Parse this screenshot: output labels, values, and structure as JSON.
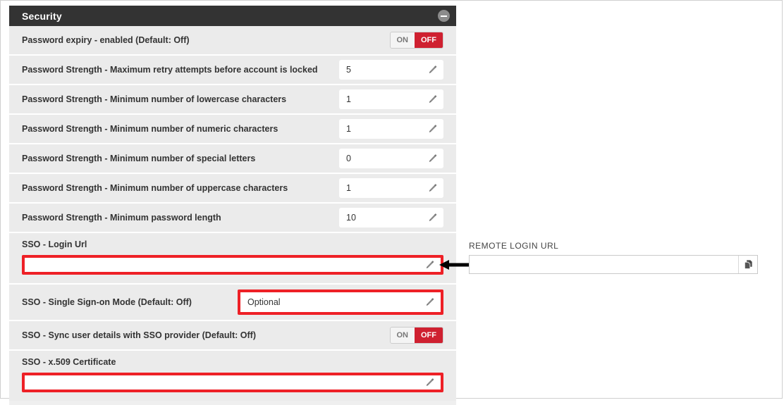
{
  "panel": {
    "title": "Security",
    "collapse_icon": "minus-circle-icon",
    "rows": [
      {
        "label": "Password expiry - enabled (Default: Off)",
        "control": "toggle",
        "toggle": {
          "on_label": "ON",
          "off_label": "OFF",
          "state": "OFF"
        }
      },
      {
        "label": "Password Strength - Maximum retry attempts before account is locked",
        "control": "value",
        "value": "5"
      },
      {
        "label": "Password Strength - Minimum number of lowercase characters",
        "control": "value",
        "value": "1"
      },
      {
        "label": "Password Strength - Minimum number of numeric characters",
        "control": "value",
        "value": "1"
      },
      {
        "label": "Password Strength - Minimum number of special letters",
        "control": "value",
        "value": "0"
      },
      {
        "label": "Password Strength - Minimum number of uppercase characters",
        "control": "value",
        "value": "1"
      },
      {
        "label": "Password Strength - Minimum password length",
        "control": "value",
        "value": "10"
      },
      {
        "label": "SSO - Login Url",
        "control": "stacked-input",
        "value": "",
        "highlighted": true
      },
      {
        "label": "SSO - Single Sign-on Mode (Default: Off)",
        "control": "value",
        "value": "Optional",
        "highlighted": true
      },
      {
        "label": "SSO - Sync user details with SSO provider (Default: Off)",
        "control": "toggle",
        "toggle": {
          "on_label": "ON",
          "off_label": "OFF",
          "state": "OFF"
        }
      },
      {
        "label": "SSO - x.509 Certificate",
        "control": "stacked-input",
        "value": "",
        "highlighted": true
      }
    ]
  },
  "remote_login": {
    "label": "REMOTE LOGIN URL",
    "value": "",
    "placeholder": "",
    "copy_icon": "copy-icon"
  },
  "annotation": {
    "arrow_icon": "left-arrow-icon"
  },
  "colors": {
    "header_bg": "#333333",
    "row_bg": "#ebebeb",
    "highlight": "#ee2026",
    "toggle_off": "#cf2030",
    "panel_bg": "#efefef"
  }
}
